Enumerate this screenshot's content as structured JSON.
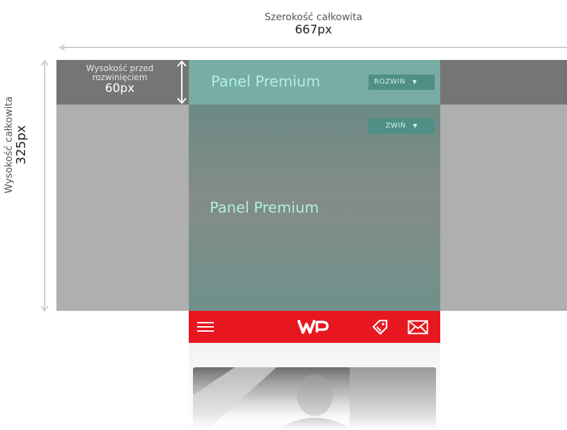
{
  "annotations": {
    "total_width_label": "Szerokość całkowita",
    "total_width_value": "667px",
    "total_height_label": "Wysokość całkowita",
    "total_height_value": "325px",
    "pre_expand_label": "Wysokość przed rozwinięciem",
    "pre_expand_value": "60px"
  },
  "panel": {
    "collapsed_title": "Panel Premium",
    "expand_button": "ROZWIŃ",
    "collapse_button": "ZWIŃ",
    "expanded_title": "Panel Premium"
  },
  "wp_bar": {
    "logo": "WP",
    "icons": [
      "menu-icon",
      "wp-logo-icon",
      "tag-icon",
      "mail-icon"
    ]
  },
  "colors": {
    "panel_collapsed": "#78ada4",
    "panel_text": "#aef0e6",
    "button_bg": "#4f8f86",
    "wp_red": "#e8171f",
    "region_dark": "#757575",
    "region_light": "#afafaf"
  }
}
